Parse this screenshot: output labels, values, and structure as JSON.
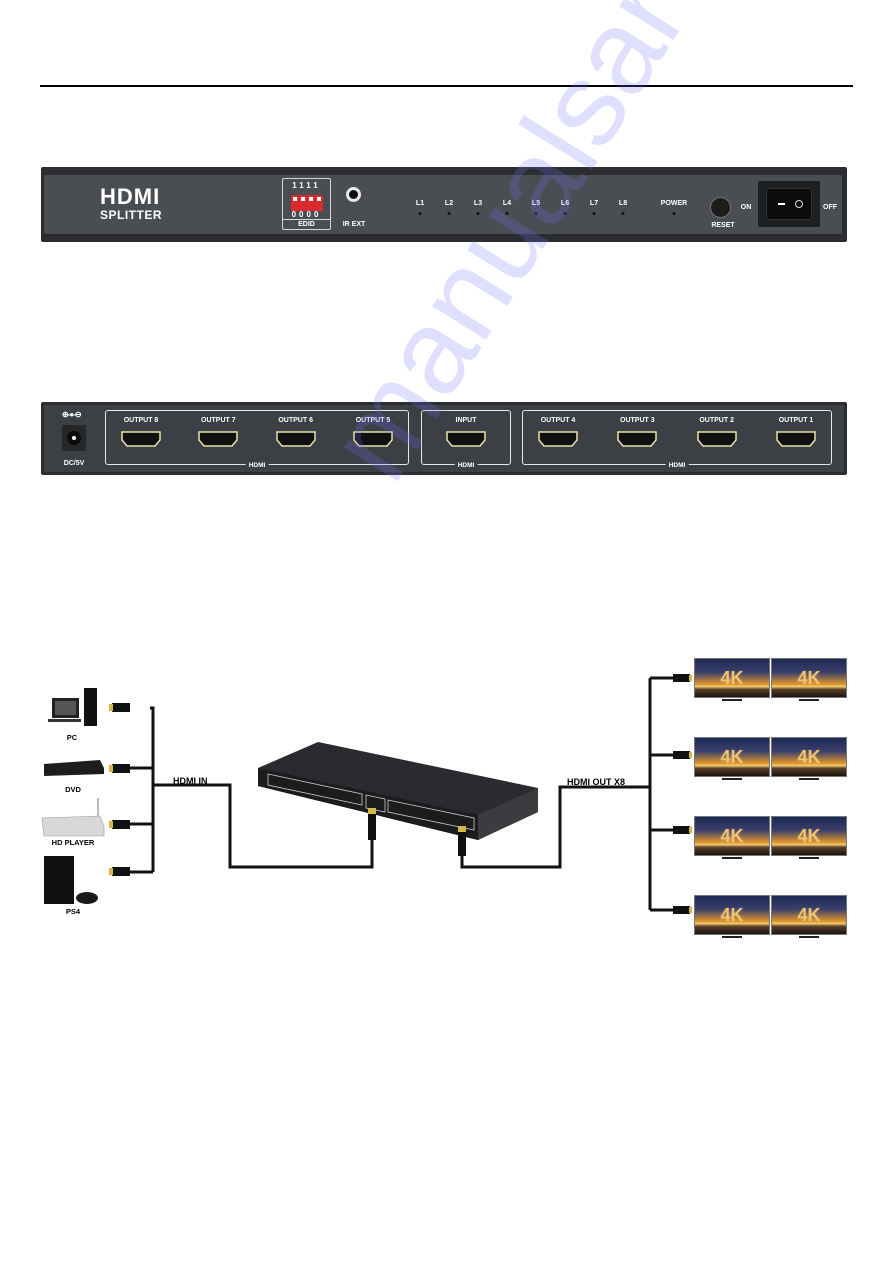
{
  "page": {
    "watermark": "manualsarchive.com"
  },
  "front_panel": {
    "brand_line1": "HDMI",
    "brand_line2": "SPLITTER",
    "edid": {
      "top_digits": "1111",
      "bottom_digits": "0000",
      "label": "EDID",
      "dip_color": "#d82a2f"
    },
    "ir_label": "IR EXT",
    "leds": [
      "L1",
      "L2",
      "L3",
      "L4",
      "L5",
      "L6",
      "L7",
      "L8"
    ],
    "power_label": "POWER",
    "reset_label": "RESET",
    "switch_on_label": "ON",
    "switch_off_label": "OFF"
  },
  "rear_panel": {
    "power_symbol": "⊕-●-⊖",
    "power_label": "DC/5V",
    "groups": [
      {
        "caption": "HDMI",
        "ports": [
          "OUTPUT 8",
          "OUTPUT 7",
          "OUTPUT 6",
          "OUTPUT 5"
        ]
      },
      {
        "caption": "HDMI",
        "ports": [
          "INPUT"
        ]
      },
      {
        "caption": "HDMI",
        "ports": [
          "OUTPUT 4",
          "OUTPUT 3",
          "OUTPUT 2",
          "OUTPUT 1"
        ]
      }
    ],
    "port_accent": "#e9e3a8"
  },
  "diagram": {
    "input_label": "HDMI IN",
    "output_label": "HDMI OUT X8",
    "sources": [
      "PC",
      "DVD",
      "HD PLAYER",
      "PS4"
    ],
    "display_badge": "4K",
    "display_count": 8
  }
}
